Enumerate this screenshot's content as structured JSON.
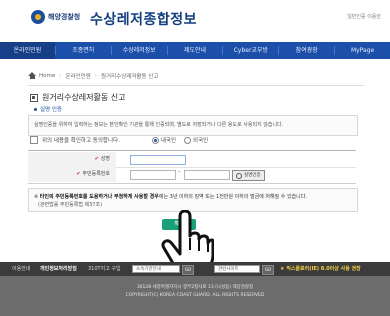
{
  "header": {
    "logo_text": "해양경찰청",
    "site_title": "수상레저종합정보",
    "util_links": "일반인증 이용안"
  },
  "gnb": {
    "items": [
      "온라인민원",
      "조종면허",
      "수상레저정보",
      "제도안내",
      "Cyber교부방",
      "참여광장",
      "MyPage"
    ]
  },
  "breadcrumb": {
    "items": [
      "Home",
      "온라인민원",
      "원거리수상레저활동 신고"
    ]
  },
  "page": {
    "title": "원거리수상레저활동 신고",
    "section_tag": "실명 인증",
    "notice": "실명인증을 위하여 입력하는 정보는 본인확인 기관을 통해 인증되며, 별도로 저장되거나 다른 용도로 사용되지 않습니다.",
    "agree_label": "위의 내용을 확인하고 동의합니다.",
    "radio_domestic": "내국인",
    "radio_foreign": "외국인"
  },
  "form": {
    "name_label": "성명",
    "rrn_label": "주민등록번호",
    "rrn_dash": "-",
    "verify_button": "실명인증"
  },
  "warning": {
    "line1_prefix": "※ ",
    "line1_bold": "타인의 주민등록번호를 도용하거나 부정하게 사용할 경우",
    "line1_rest": "에는 3년 이하의 징역 또는 1천만원 이하의 벌금에 처해질 수 있습니다.",
    "line2": "(관련법률 주민등록법 제37조)"
  },
  "confirm_button": "확인",
  "footer": {
    "link1": "이용안내",
    "link2": "개인정보처리방침",
    "link3": "310T지고 구입",
    "select1": "소속기관안내",
    "select2": "관련사이트",
    "go": "GO",
    "promo": "★ 익스플로러(IE) 8.0이상 사용 권장",
    "address": "30128 세종특별자치시 정부2청사로 13 (나성동) 해양경찰청",
    "copyright": "COPYRIGHT(C) KOREA COAST GUARD. ALL RIGHTS RESERVED"
  },
  "colors": {
    "gnb": "#1c4faa",
    "confirm": "#17a07a",
    "footer": "#3b3b3b"
  }
}
